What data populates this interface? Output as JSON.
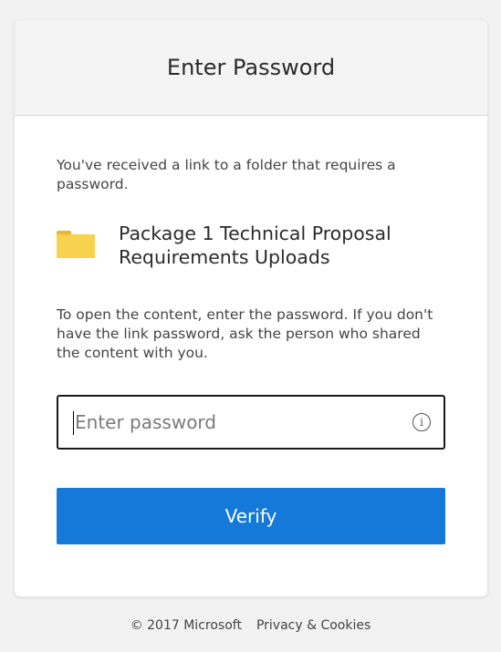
{
  "dialog": {
    "title": "Enter Password",
    "intro": "You've received a link to a folder that requires a password.",
    "folder": {
      "icon": "folder-icon",
      "name": "Package 1 Technical Proposal Requirements Uploads"
    },
    "instructions": "To open the content, enter the password. If you don't have the link password, ask the person who shared the content with you.",
    "password_input": {
      "value": "",
      "placeholder": "Enter password",
      "info_icon": "info-icon"
    },
    "verify_label": "Verify"
  },
  "footer": {
    "copyright": "© 2017 Microsoft",
    "privacy_link": "Privacy & Cookies"
  },
  "colors": {
    "accent": "#1479d8",
    "folder": "#f8d24e",
    "background": "#f2f2f2"
  }
}
